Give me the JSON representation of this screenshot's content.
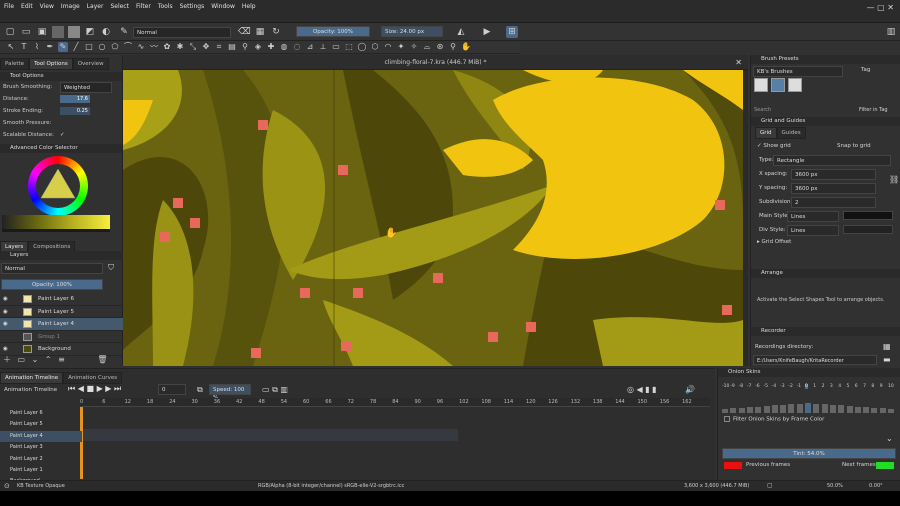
{
  "menu": [
    "File",
    "Edit",
    "View",
    "Image",
    "Layer",
    "Select",
    "Filter",
    "Tools",
    "Settings",
    "Window",
    "Help"
  ],
  "toolbar": {
    "blend_mode": "Normal",
    "opacity": "Opacity: 100%",
    "size": "Size: 24.00 px"
  },
  "tool_options": {
    "tabs": [
      "Palette",
      "Tool Options",
      "Overview"
    ],
    "header": "Tool Options",
    "brush_smoothing_label": "Brush Smoothing:",
    "brush_smoothing_value": "Weighted",
    "distance_label": "Distance:",
    "distance_value": "17.6",
    "stroke_ending_label": "Stroke Ending:",
    "stroke_ending_value": "0.25",
    "smooth_pressure": "Smooth Pressure:",
    "scalable_distance": "Scalable Distance:"
  },
  "color_selector": {
    "header": "Advanced Color Selector"
  },
  "layers": {
    "tabs": [
      "Layers",
      "Compositions"
    ],
    "header": "Layers",
    "blend": "Normal",
    "opacity": "Opacity: 100%",
    "items": [
      "Paint Layer 6",
      "Paint Layer 5",
      "Paint Layer 4",
      "Group 1",
      "Background"
    ]
  },
  "document": {
    "title": "climbing-floral-7.kra (446.7 MiB) *"
  },
  "brush_presets": {
    "header": "Brush Presets",
    "set": "KB's Brushes",
    "tag": "Tag",
    "search": "Search",
    "filter": "Filter in Tag"
  },
  "grid": {
    "header": "Grid and Guides",
    "tabs": [
      "Grid",
      "Guides"
    ],
    "show_grid": "Show grid",
    "snap": "Snap to grid",
    "type_label": "Type:",
    "type": "Rectangle",
    "xspacing_label": "X spacing:",
    "xspacing": "3600 px",
    "yspacing_label": "Y spacing:",
    "yspacing": "3600 px",
    "subdivision_label": "Subdivision:",
    "subdivision": "2",
    "main_style_label": "Main Style:",
    "main_style": "Lines",
    "div_style_label": "Div Style:",
    "div_style": "Lines",
    "offset": "Grid Offset"
  },
  "arrange": {
    "header": "Arrange",
    "text": "Activate the Select Shapes Tool to arrange objects."
  },
  "recorder": {
    "header": "Recorder",
    "label": "Recordings directory:",
    "path": "E:/Users/KnifeBaugh/KritaRecorder"
  },
  "animation": {
    "tabs": [
      "Animation Timeline",
      "Animation Curves"
    ],
    "header": "Animation Timeline",
    "frame": "0",
    "speed": "Speed: 100 %",
    "ruler": [
      "0",
      "6",
      "12",
      "18",
      "24",
      "30",
      "36",
      "42",
      "48",
      "54",
      "60",
      "66",
      "72",
      "78",
      "84",
      "90",
      "96",
      "102",
      "108",
      "114",
      "120",
      "126",
      "132",
      "138",
      "144",
      "150",
      "156",
      "162"
    ],
    "layers": [
      "Paint Layer 6",
      "Paint Layer 5",
      "Paint Layer 4",
      "Paint Layer 3",
      "Paint Layer 2",
      "Paint Layer 1",
      "Background"
    ]
  },
  "onion": {
    "header": "Onion Skins",
    "numbers": [
      "-10",
      "-9",
      "-8",
      "-7",
      "-6",
      "-5",
      "-4",
      "-3",
      "-2",
      "-1",
      "0",
      "1",
      "2",
      "3",
      "4",
      "5",
      "6",
      "7",
      "8",
      "9",
      "10"
    ],
    "filter": "Filter Onion Skins by Frame Color",
    "tint": "Tint: 54.0%",
    "prev": "Previous frames",
    "next": "Next frames",
    "prev_color": "#e81010",
    "next_color": "#22dd22"
  },
  "status": {
    "left": "KB Texture Opaque",
    "mid": "RGB/Alpha (8-bit integer/channel)  sRGB-elle-V2-srgbtrc.icc",
    "right": "3,600 x 3,600 (446.7 MiB)",
    "zoom": "50.0%",
    "rotation": "0.00°"
  },
  "colors": {
    "canvas_bg": "#6e6a12",
    "petal": "#f1c40f",
    "accent": "#e8685c",
    "selection": "#4a6a8c"
  }
}
